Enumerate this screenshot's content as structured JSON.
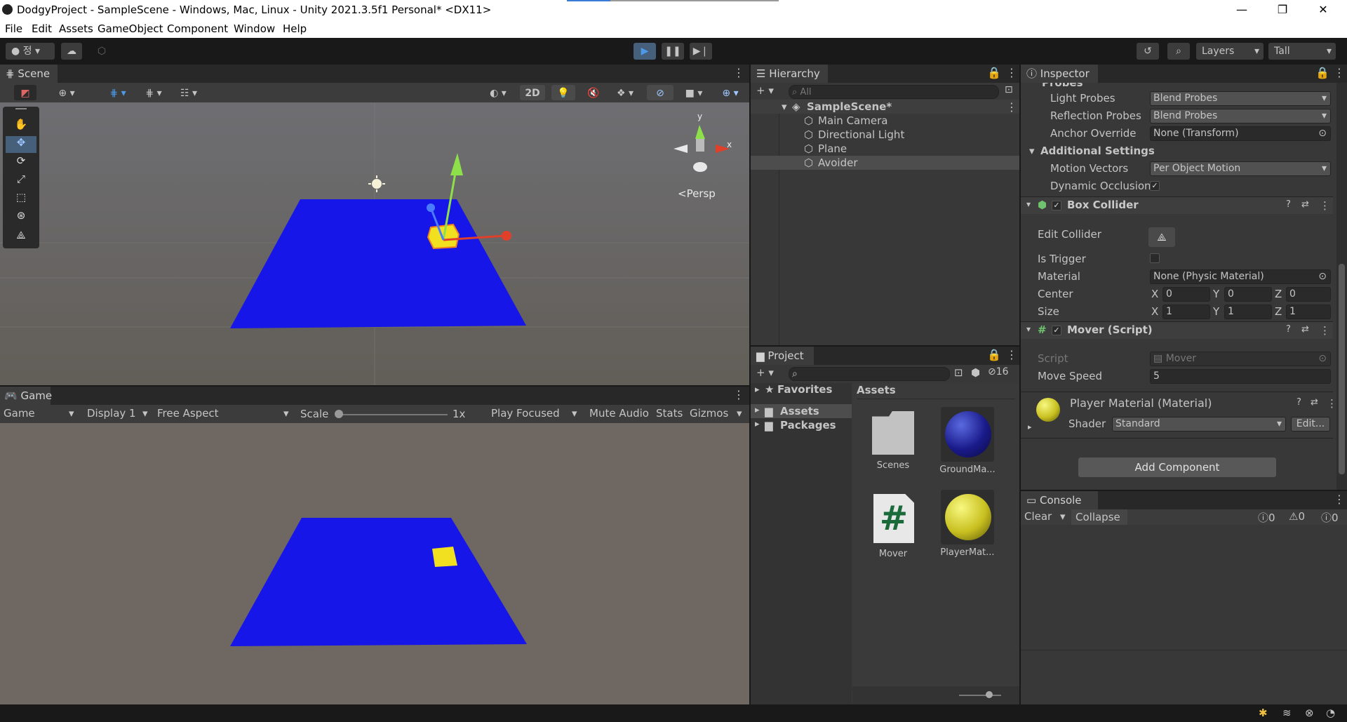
{
  "window": {
    "title": "DodgyProject - SampleScene - Windows, Mac, Linux - Unity 2021.3.5f1 Personal* <DX11>",
    "controls": {
      "minimize": "—",
      "maximize": "❐",
      "close": "✕"
    }
  },
  "menu": [
    "File",
    "Edit",
    "Assets",
    "GameObject",
    "Component",
    "Window",
    "Help"
  ],
  "toolbar": {
    "account_label": "정",
    "layers": "Layers",
    "layout": "Tall"
  },
  "scene": {
    "tab": "Scene",
    "toggle_2d": "2D",
    "persp_label": "<Persp",
    "gizmo_axes": {
      "x": "x",
      "y": "y"
    }
  },
  "game": {
    "tab": "Game",
    "view": "Game",
    "display": "Display 1",
    "aspect": "Free Aspect",
    "scale_label": "Scale",
    "scale_value": "1x",
    "play_mode": "Play Focused",
    "mute": "Mute Audio",
    "stats": "Stats",
    "gizmos": "Gizmos"
  },
  "hierarchy": {
    "tab": "Hierarchy",
    "search_placeholder": "All",
    "scene": "SampleScene*",
    "items": [
      "Main Camera",
      "Directional Light",
      "Plane",
      "Avoider"
    ]
  },
  "project": {
    "tab": "Project",
    "hidden_count": "16",
    "favorites": "Favorites",
    "folders": [
      "Assets",
      "Packages"
    ],
    "breadcrumb": "Assets",
    "assets": [
      {
        "name": "Scenes",
        "kind": "folder"
      },
      {
        "name": "GroundMa...",
        "kind": "material-blue"
      },
      {
        "name": "Mover",
        "kind": "script"
      },
      {
        "name": "PlayerMat...",
        "kind": "material-yellow"
      }
    ]
  },
  "inspector": {
    "tab": "Inspector",
    "cut_header": "Probes",
    "light_probes_label": "Light Probes",
    "light_probes_value": "Blend Probes",
    "reflection_probes_label": "Reflection Probes",
    "reflection_probes_value": "Blend Probes",
    "anchor_label": "Anchor Override",
    "anchor_value": "None (Transform)",
    "additional_settings": "Additional Settings",
    "motion_vectors_label": "Motion Vectors",
    "motion_vectors_value": "Per Object Motion",
    "dynamic_occlusion_label": "Dynamic Occlusion",
    "box_collider": {
      "title": "Box Collider",
      "edit_collider": "Edit Collider",
      "is_trigger": "Is Trigger",
      "material_label": "Material",
      "material_value": "None (Physic Material)",
      "center_label": "Center",
      "center": {
        "x": "0",
        "y": "0",
        "z": "0"
      },
      "size_label": "Size",
      "size": {
        "x": "1",
        "y": "1",
        "z": "1"
      }
    },
    "mover": {
      "title": "Mover (Script)",
      "script_label": "Script",
      "script_value": "Mover",
      "speed_label": "Move Speed",
      "speed_value": "5"
    },
    "material": {
      "title": "Player Material (Material)",
      "shader_label": "Shader",
      "shader_value": "Standard",
      "edit": "Edit..."
    },
    "add_component": "Add Component",
    "axis_labels": {
      "x": "X",
      "y": "Y",
      "z": "Z"
    }
  },
  "console": {
    "tab": "Console",
    "clear": "Clear",
    "collapse": "Collapse",
    "counts": {
      "log": "0",
      "warn": "0",
      "error": "0"
    }
  },
  "colors": {
    "accent": "#4d78cc",
    "plane": "#1010e0",
    "cube": "#f0e020"
  }
}
